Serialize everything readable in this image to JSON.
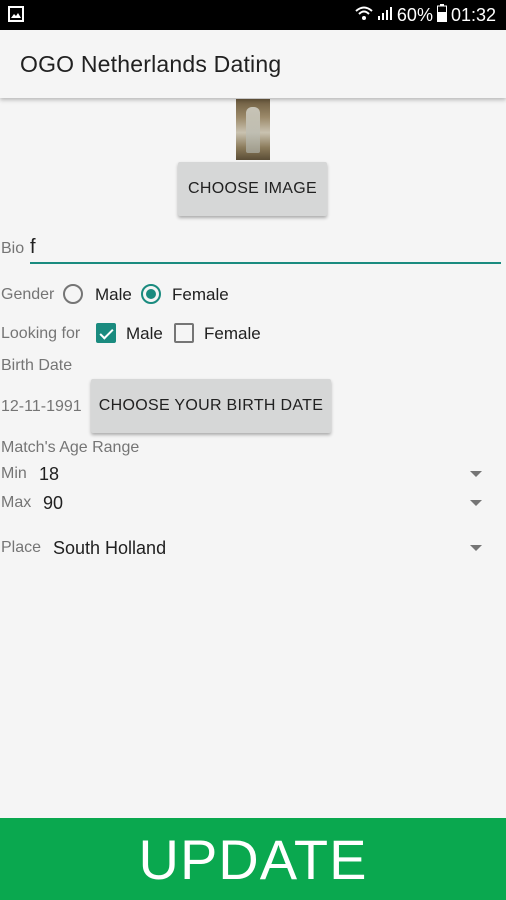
{
  "status_bar": {
    "battery": "60%",
    "time": "01:32"
  },
  "app_bar": {
    "title": "OGO Netherlands Dating"
  },
  "profile": {
    "choose_image_label": "CHOOSE IMAGE"
  },
  "bio": {
    "label": "Bio",
    "value": "f"
  },
  "gender": {
    "label": "Gender",
    "options": [
      "Male",
      "Female"
    ],
    "selected": "Female"
  },
  "looking_for": {
    "label": "Looking for",
    "options": [
      "Male",
      "Female"
    ],
    "checked": [
      "Male"
    ]
  },
  "birth_date": {
    "label": "Birth Date",
    "value": "12-11-1991",
    "button_label": "CHOOSE YOUR BIRTH DATE"
  },
  "age_range": {
    "label": "Match's Age Range",
    "min_label": "Min",
    "min_value": "18",
    "max_label": "Max",
    "max_value": "90"
  },
  "place": {
    "label": "Place",
    "value": "South Holland"
  },
  "update_button": {
    "label": "UPDATE"
  },
  "colors": {
    "accent": "#1a8b7f",
    "update": "#0aa84f"
  }
}
